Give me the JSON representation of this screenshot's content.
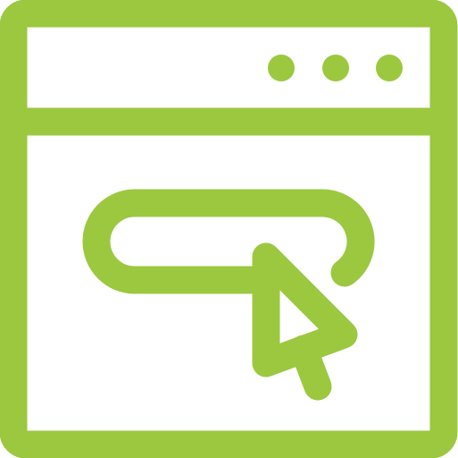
{
  "icon": {
    "name": "browser-click-icon",
    "color": "#9bc83f",
    "parts": [
      "browser-window-icon",
      "window-dots-icon",
      "button-pill-icon",
      "mouse-cursor-icon"
    ]
  }
}
